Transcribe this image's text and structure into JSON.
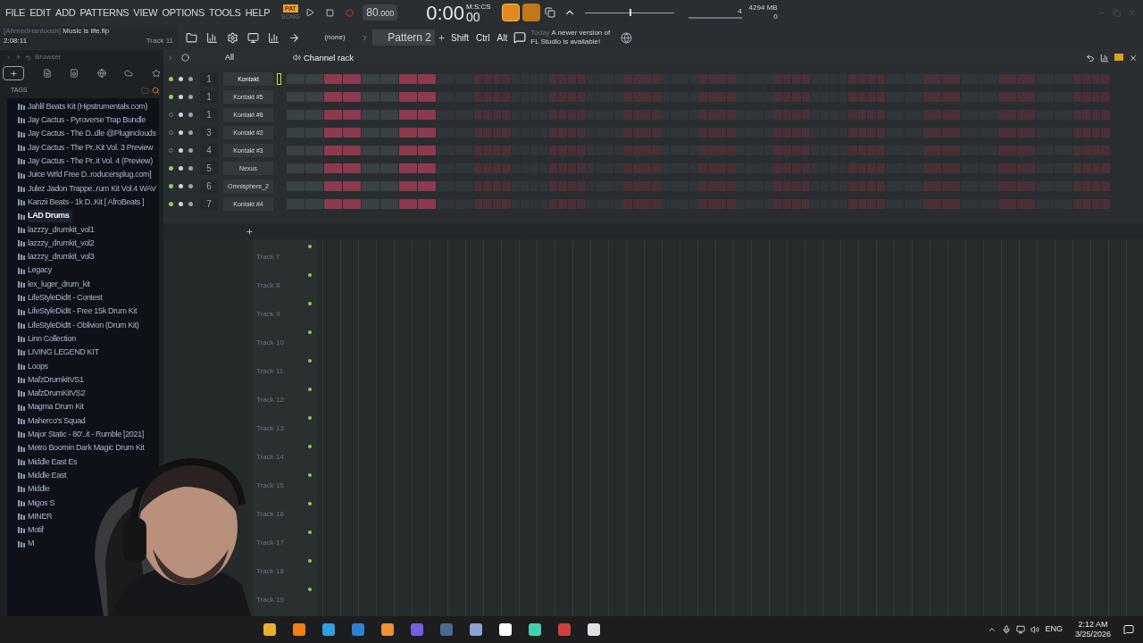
{
  "menu": [
    "FILE",
    "EDIT",
    "ADD",
    "PATTERNS",
    "VIEW",
    "OPTIONS",
    "TOOLS",
    "HELP"
  ],
  "transport": {
    "mode_top": "PAT",
    "mode_bottom": "SONG",
    "tempo": "80",
    "tempo_fraction": ".000",
    "time": "0:00",
    "time_cs": "00",
    "time_label": "M:S:CS",
    "step_number": "4",
    "master_pitch": {
      "level": 0.5
    },
    "memory": "4294 MB",
    "cpu": "0"
  },
  "project": {
    "user": "[AhmedHantoosh]",
    "file": "Music is life.flp",
    "time": "2:08:11",
    "track": "Track 11"
  },
  "toolbar": {
    "pattern_select": "(none)",
    "pattern": "Pattern 2",
    "keys": [
      "Shift",
      "Ctrl",
      "Alt"
    ],
    "news_day": "Today",
    "news_lines": [
      "A newer version of",
      "FL Studio is available!"
    ]
  },
  "browser": {
    "title": "Browser",
    "tags_label": "TAGS",
    "items": [
      {
        "label": "Jahlil Beats Kit (Hipstrumentals.com)",
        "selected": false
      },
      {
        "label": "Jay Cactus - Pyroverse Trap Bundle",
        "selected": false
      },
      {
        "label": "Jay Cactus - The D..dle @Pluginclouds",
        "selected": false
      },
      {
        "label": "Jay Cactus - The Pr..Kit Vol. 3 Preview",
        "selected": false
      },
      {
        "label": "Jay Cactus - The Pr..it Vol. 4 (Preview)",
        "selected": false
      },
      {
        "label": "Juice Wrld Free D..roducersplug.com]",
        "selected": false
      },
      {
        "label": "Julez Jadon Trappe..rum Kit Vol.4 WAV",
        "selected": false
      },
      {
        "label": "Kanzii Beats - 1k D..Kit [ AfroBeats ]",
        "selected": false
      },
      {
        "label": "LAD Drums",
        "selected": true
      },
      {
        "label": "lazzzy_drumkit_vol1",
        "selected": false
      },
      {
        "label": "lazzzy_drumkit_vol2",
        "selected": false
      },
      {
        "label": "lazzzy_drumkit_vol3",
        "selected": false
      },
      {
        "label": "Legacy",
        "selected": false
      },
      {
        "label": "lex_luger_drum_kit",
        "selected": false
      },
      {
        "label": "LifeStyleDidIt - Contest",
        "selected": false
      },
      {
        "label": "LifeStyleDidIt - Free 15k Drum Kit",
        "selected": false
      },
      {
        "label": "LifeStyleDidIt - Oblivion (Drum Kit)",
        "selected": false
      },
      {
        "label": "Linn Collection",
        "selected": false
      },
      {
        "label": "LIVING LEGEND KIT",
        "selected": false
      },
      {
        "label": "Loops",
        "selected": false
      },
      {
        "label": "MafzDrumkitVS1",
        "selected": false
      },
      {
        "label": "MafzDrumKitVS2",
        "selected": false
      },
      {
        "label": "Magma Drum Kit",
        "selected": false
      },
      {
        "label": "Maherco's Squad",
        "selected": false
      },
      {
        "label": "Major Static - 80'..it - Rumble [2021]",
        "selected": false
      },
      {
        "label": "Metro Boomin Dark Magic Drum Kit",
        "selected": false
      },
      {
        "label": "Middle East Es",
        "selected": false
      },
      {
        "label": "Middle East",
        "selected": false
      },
      {
        "label": "Middle",
        "selected": false
      },
      {
        "label": "Migos S",
        "selected": false
      },
      {
        "label": "MINER",
        "selected": false
      },
      {
        "label": "Motif",
        "selected": false
      },
      {
        "label": "M",
        "selected": false
      }
    ]
  },
  "channel_rack": {
    "filter": "All",
    "title": "Channel rack",
    "channels": [
      {
        "on": true,
        "selected": true,
        "route": "1",
        "name": "Kontakt",
        "steps": [
          false,
          false,
          false,
          false,
          true,
          true,
          true,
          true,
          false,
          false,
          false,
          false,
          true,
          true,
          true,
          true
        ]
      },
      {
        "on": true,
        "selected": false,
        "route": "1",
        "name": "Kontakt #5",
        "steps": [
          false,
          false,
          false,
          false,
          true,
          true,
          true,
          true,
          false,
          false,
          false,
          false,
          true,
          true,
          true,
          true
        ]
      },
      {
        "on": false,
        "selected": false,
        "route": "1",
        "name": "Kontakt #6",
        "steps": [
          false,
          false,
          false,
          false,
          true,
          true,
          true,
          true,
          false,
          false,
          false,
          false,
          true,
          true,
          true,
          true
        ]
      },
      {
        "on": false,
        "selected": false,
        "route": "3",
        "name": "Kontakt #2",
        "steps": [
          false,
          false,
          false,
          false,
          true,
          true,
          true,
          true,
          false,
          false,
          false,
          false,
          true,
          true,
          true,
          true
        ]
      },
      {
        "on": false,
        "selected": false,
        "route": "4",
        "name": "Kontakt #3",
        "steps": [
          false,
          false,
          false,
          false,
          true,
          true,
          true,
          true,
          false,
          false,
          false,
          false,
          true,
          true,
          true,
          true
        ]
      },
      {
        "on": true,
        "selected": false,
        "route": "5",
        "name": "Nexus",
        "steps": [
          false,
          false,
          false,
          false,
          true,
          true,
          true,
          true,
          false,
          false,
          false,
          false,
          true,
          true,
          true,
          true
        ]
      },
      {
        "on": true,
        "selected": false,
        "route": "6",
        "name": "Omnisphere_2",
        "steps": [
          false,
          false,
          false,
          false,
          true,
          true,
          true,
          true,
          false,
          false,
          false,
          false,
          true,
          true,
          true,
          true
        ]
      },
      {
        "on": true,
        "selected": false,
        "route": "7",
        "name": "Kontakt #4",
        "steps": [
          false,
          false,
          false,
          false,
          true,
          true,
          true,
          true,
          false,
          false,
          false,
          false,
          true,
          true,
          true,
          true
        ]
      }
    ]
  },
  "playlist": {
    "tracks": [
      "Track 7",
      "Track 8",
      "Track 9",
      "Track 10",
      "Track 11",
      "Track 12",
      "Track 13",
      "Track 14",
      "Track 15",
      "Track 16",
      "Track 17",
      "Track 18",
      "Track 19"
    ]
  },
  "taskbar": {
    "language": "ENG",
    "time": "2:12 AM",
    "date": "3/25/2026"
  }
}
